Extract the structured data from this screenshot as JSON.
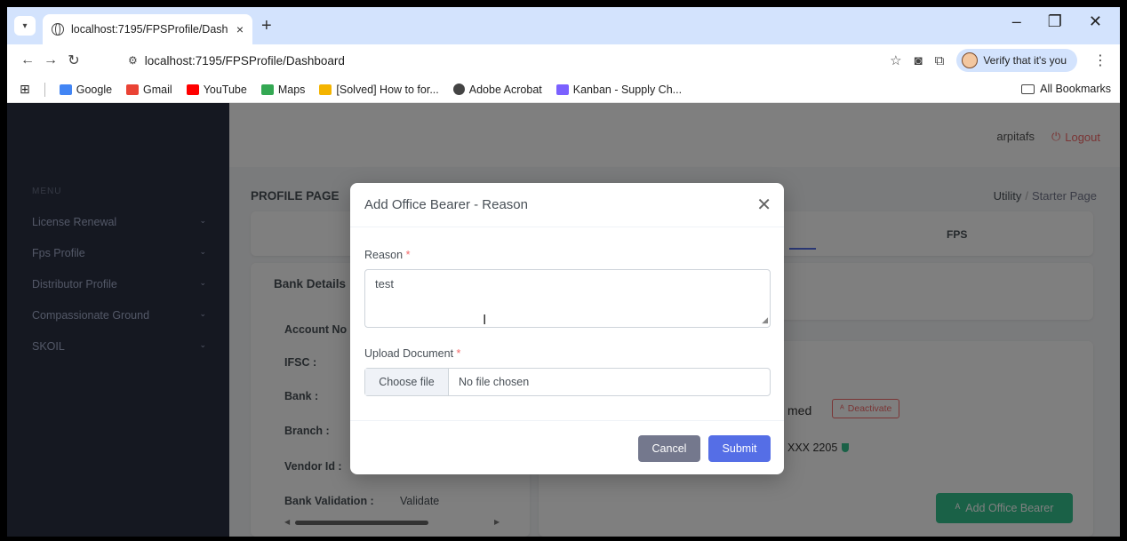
{
  "browser": {
    "tab_title": "localhost:7195/FPSProfile/Dash",
    "tab_close": "×",
    "new_tab": "+",
    "url": "localhost:7195/FPSProfile/Dashboard",
    "verify_label": "Verify that it's you",
    "bookmarks": [
      {
        "label": "Google",
        "color": "#4285f4"
      },
      {
        "label": "Gmail",
        "color": "#ea4335"
      },
      {
        "label": "YouTube",
        "color": "#ff0000"
      },
      {
        "label": "Maps",
        "color": "#34a853"
      },
      {
        "label": "[Solved] How to for...",
        "color": "#f4b400"
      },
      {
        "label": "Adobe Acrobat",
        "color": "#444444"
      },
      {
        "label": "Kanban - Supply Ch...",
        "color": "#7b61ff"
      }
    ],
    "all_bookmarks": "All Bookmarks"
  },
  "sidebar": {
    "menu_heading": "MENU",
    "items": [
      {
        "label": "License Renewal"
      },
      {
        "label": "Fps Profile"
      },
      {
        "label": "Distributor Profile"
      },
      {
        "label": "Compassionate Ground"
      },
      {
        "label": "SKOIL"
      }
    ]
  },
  "topbar": {
    "username": "arpitafs",
    "logout": "Logout"
  },
  "page": {
    "title": "PROFILE PAGE",
    "breadcrumb": {
      "parent": "Utility",
      "separator": "/",
      "current": "Starter Page"
    },
    "fps_tab": "FPS",
    "bank": {
      "title": "Bank Details",
      "rows": [
        "Account No :",
        "IFSC :",
        "Bank :",
        "Branch :",
        "Vendor Id :",
        "Bank Validation :"
      ],
      "validation_value": "Validate"
    },
    "bearer": {
      "name_fragment": "med",
      "deactivate": "Deactivate",
      "masked_number": "XXX 2205"
    },
    "add_office_bearer": "Add Office Bearer"
  },
  "modal": {
    "title": "Add Office Bearer - Reason",
    "reason_label": "Reason",
    "reason_value": "test",
    "upload_label": "Upload Document",
    "required_mark": "*",
    "choose_file": "Choose file",
    "no_file": "No file chosen",
    "cancel": "Cancel",
    "submit": "Submit"
  },
  "colors": {
    "sidebar_bg": "#2a3042",
    "primary": "#556ee6",
    "success": "#34c38f",
    "danger": "#f46a6a",
    "secondary": "#74788d"
  }
}
